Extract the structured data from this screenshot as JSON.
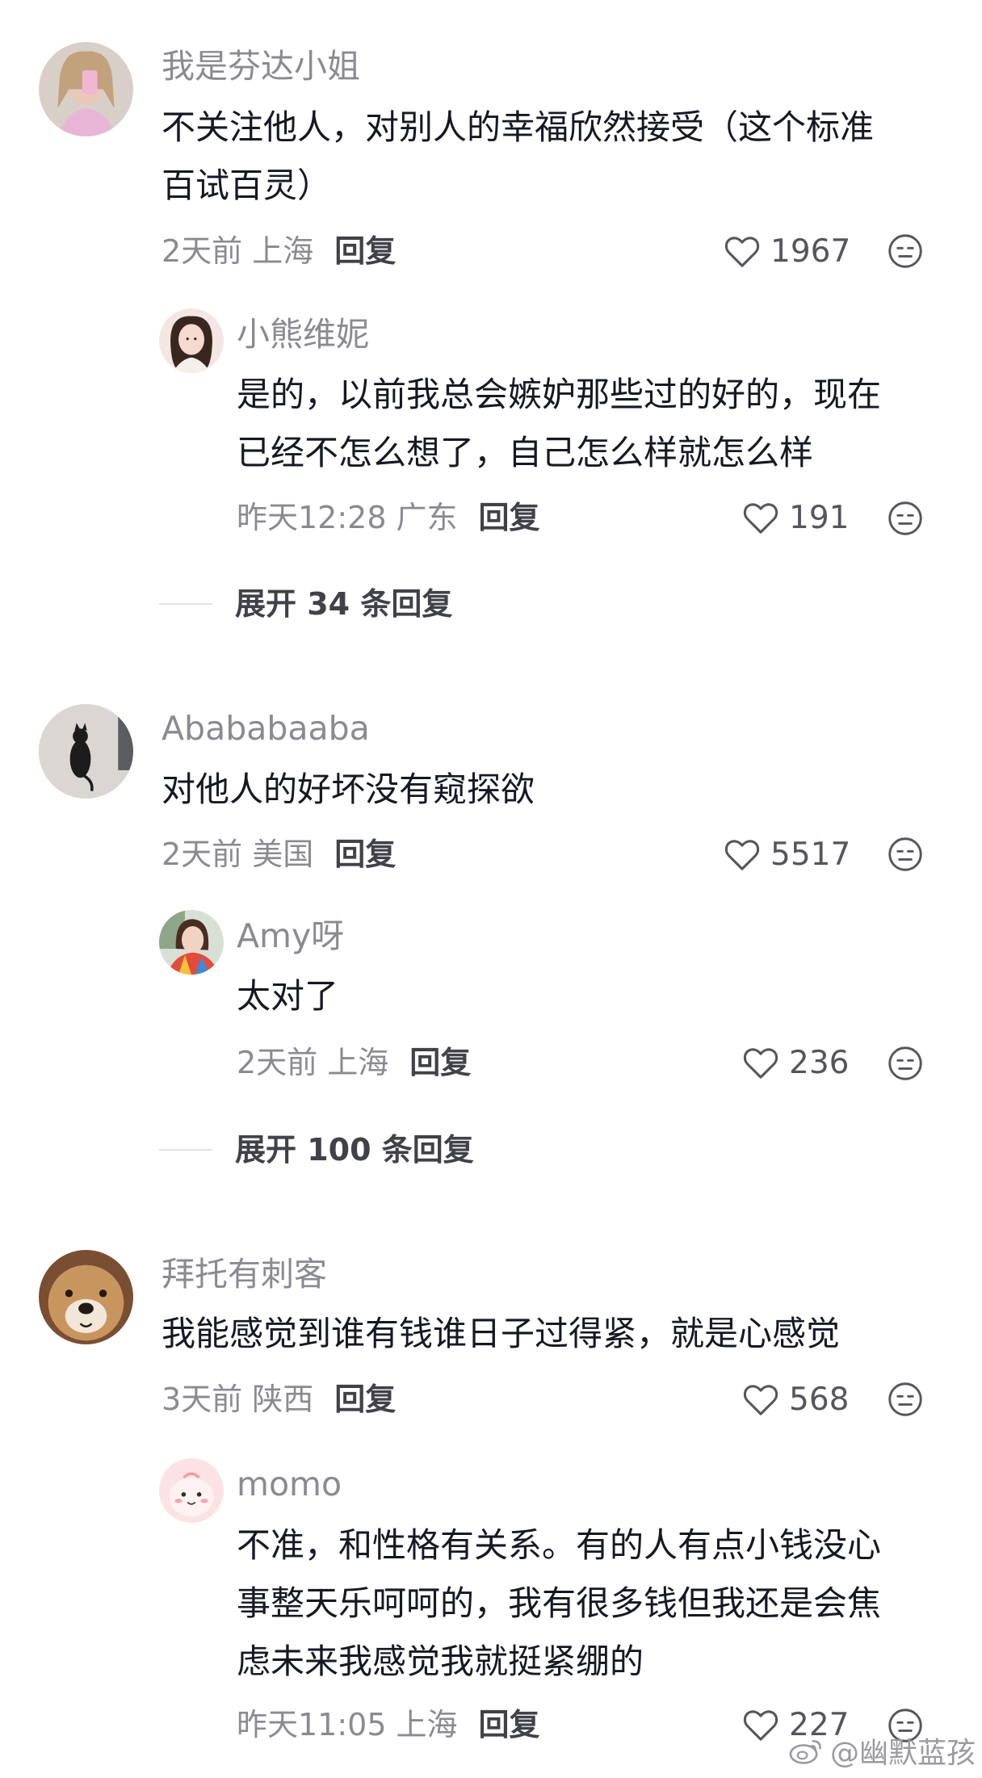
{
  "comments": [
    {
      "username": "我是芬达小姐",
      "content_lines": [
        "不关注他人，对别人的幸福欣然接受（这个标准",
        "百试百灵）"
      ],
      "time": "2天前",
      "location": "上海",
      "reply_label": "回复",
      "likes": "1967",
      "replies": [
        {
          "username": "小熊维妮",
          "content_lines": [
            "是的，以前我总会嫉妒那些过的好的，现在",
            "已经不怎么想了，自己怎么样就怎么样"
          ],
          "time": "昨天12:28",
          "location": "广东",
          "reply_label": "回复",
          "likes": "191"
        }
      ],
      "expand_label": "展开 34 条回复"
    },
    {
      "username": "Abababaaba",
      "content_lines": [
        "对他人的好坏没有窥探欲"
      ],
      "time": "2天前",
      "location": "美国",
      "reply_label": "回复",
      "likes": "5517",
      "replies": [
        {
          "username": "Amy呀",
          "content_lines": [
            "太对了"
          ],
          "time": "2天前",
          "location": "上海",
          "reply_label": "回复",
          "likes": "236"
        }
      ],
      "expand_label": "展开 100 条回复"
    },
    {
      "username": "拜托有刺客",
      "content_lines": [
        "我能感觉到谁有钱谁日子过得紧，就是心感觉"
      ],
      "time": "3天前",
      "location": "陕西",
      "reply_label": "回复",
      "likes": "568",
      "replies": [
        {
          "username": "momo",
          "content_lines": [
            "不准，和性格有关系。有的人有点小钱没心",
            "事整天乐呵呵的，我有很多钱但我还是会焦",
            "虑未来我感觉我就挺紧绷的"
          ],
          "time": "昨天11:05",
          "location": "上海",
          "reply_label": "回复",
          "likes": "227"
        }
      ]
    }
  ],
  "watermark": "@幽默蓝孩",
  "icons": {
    "like": "heart-outline-icon",
    "reaction": "neutral-face-icon",
    "watermark": "weibo-logo-icon"
  }
}
